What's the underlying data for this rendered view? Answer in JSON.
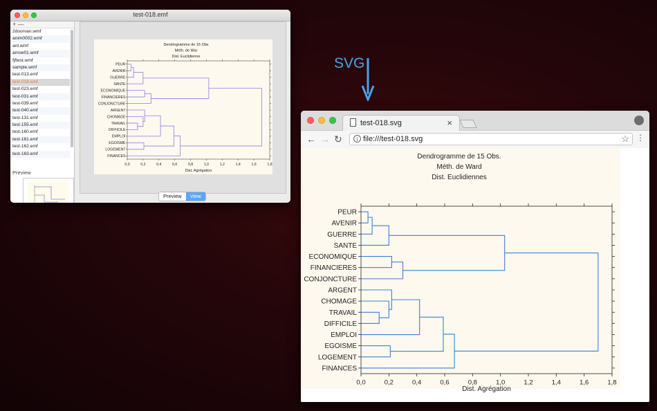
{
  "viewer": {
    "title": "test-018.emf",
    "toolbar_symbols": "+ —",
    "files": [
      "2doorvan.wmf",
      "anim0002.wmf",
      "ant.wmf",
      "arrow01.wmf",
      "fjftest.wmf",
      "sample.wmf",
      "test-013.emf",
      "test-018.emf",
      "test-023.emf",
      "test-031.emf",
      "test-039.emf",
      "test-040.emf",
      "test-131.emf",
      "test-155.emf",
      "test-160.emf",
      "test-161.emf",
      "test-162.emf",
      "test-163.emf"
    ],
    "selected_file": "test-018.emf",
    "preview_label": "Preview",
    "segments": [
      "Preview",
      "View"
    ],
    "active_segment": "View"
  },
  "arrow": {
    "label": "SVG",
    "color": "#4aa3e8"
  },
  "browser": {
    "tab_title": "test-018.svg",
    "close_glyph": "×",
    "back_glyph": "←",
    "forward_glyph": "→",
    "reload_glyph": "↻",
    "info_glyph": "i",
    "url": "file:///test-018.svg",
    "star_glyph": "☆",
    "menu_glyph": "⋮"
  },
  "chart_data": [
    {
      "type": "dendrogram",
      "title_lines": [
        "Dendrogramme de 15 Obs",
        "Méth. de War",
        "Dist. Euclidienne"
      ],
      "xlabel": "Dist. Agrégation",
      "xlim": [
        0,
        1.8
      ],
      "xticks": [
        "0,0",
        "0,2",
        "0,4",
        "0,6",
        "0,8",
        "1,0",
        "1,2",
        "1,4",
        "1,6",
        "1,8"
      ],
      "leaves": [
        "PEUR",
        "AVENIR",
        "GUERRE",
        "SANTE",
        "ECONOMIQUE",
        "FINANCIERES",
        "CONJONCTURE",
        "ARGENT",
        "CHOMAGE",
        "TRAVAIL",
        "DIFFICILE",
        "EMPLOI",
        "EGOISME",
        "LOGEMENT",
        "FINANCES"
      ]
    },
    {
      "type": "dendrogram",
      "title_lines": [
        "Dendrogramme de 15 Obs.",
        "Méth. de Ward",
        "Dist. Euclidiennes"
      ],
      "xlabel": "Dist. Agrégation",
      "xlim": [
        0,
        1.8
      ],
      "xticks": [
        "0,0",
        "0,2",
        "0,4",
        "0,6",
        "0,8",
        "1,0",
        "1,2",
        "1,4",
        "1,6",
        "1,8"
      ],
      "leaves": [
        "PEUR",
        "AVENIR",
        "GUERRE",
        "SANTE",
        "ECONOMIQUE",
        "FINANCIERES",
        "CONJONCTURE",
        "ARGENT",
        "CHOMAGE",
        "TRAVAIL",
        "DIFFICILE",
        "EMPLOI",
        "EGOISME",
        "LOGEMENT",
        "FINANCES"
      ],
      "merges": [
        {
          "a": 0,
          "b": 1,
          "height": 0.05
        },
        {
          "a": 15,
          "b": 2,
          "height": 0.08
        },
        {
          "a": 16,
          "b": 3,
          "height": 0.2
        },
        {
          "a": 4,
          "b": 5,
          "height": 0.22
        },
        {
          "a": 18,
          "b": 6,
          "height": 0.3
        },
        {
          "a": 9,
          "b": 10,
          "height": 0.13
        },
        {
          "a": 8,
          "b": 20,
          "height": 0.2
        },
        {
          "a": 7,
          "b": 21,
          "height": 0.22
        },
        {
          "a": 22,
          "b": 11,
          "height": 0.42
        },
        {
          "a": 12,
          "b": 13,
          "height": 0.21
        },
        {
          "a": 23,
          "b": 24,
          "height": 0.59
        },
        {
          "a": 25,
          "b": 14,
          "height": 0.67
        },
        {
          "a": 17,
          "b": 19,
          "height": 1.03
        },
        {
          "a": 27,
          "b": 26,
          "height": 1.7
        }
      ]
    }
  ]
}
